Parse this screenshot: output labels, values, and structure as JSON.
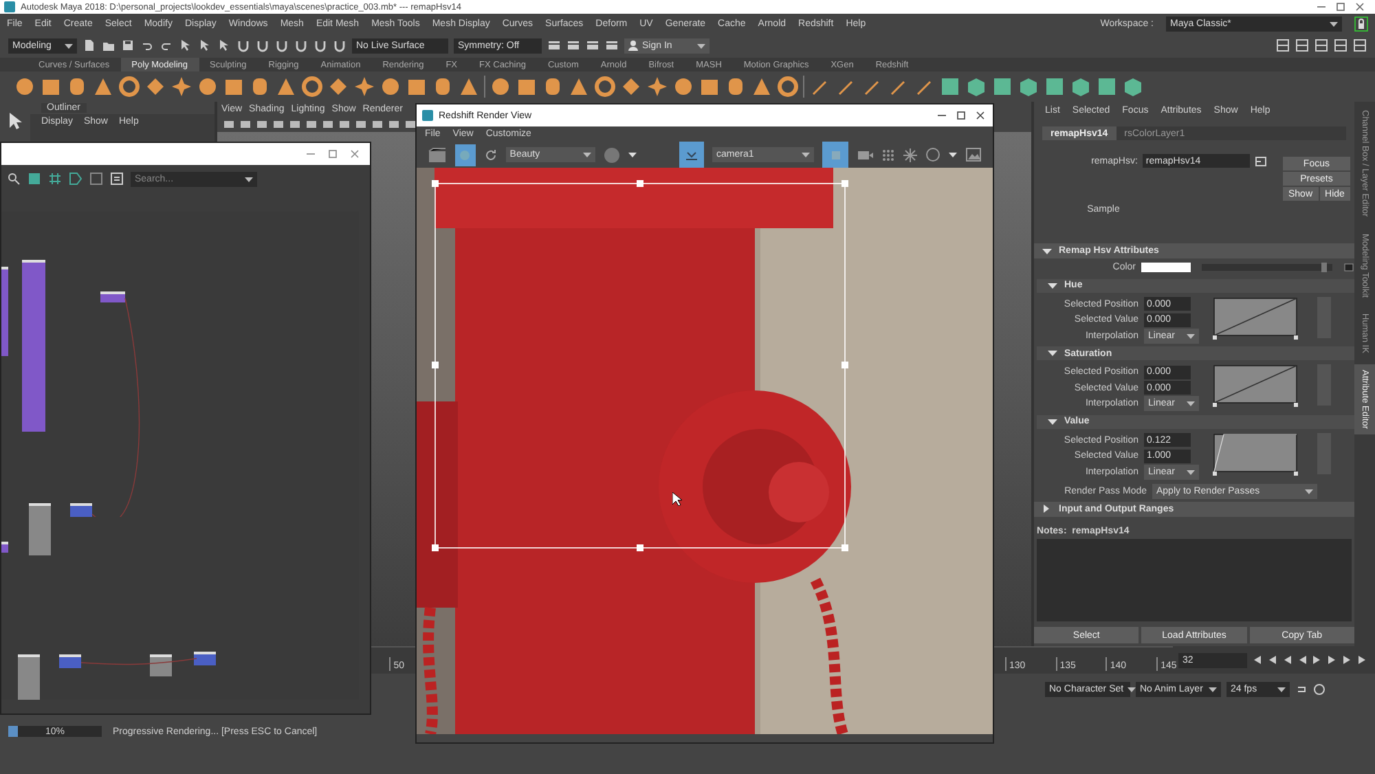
{
  "title_bar": {
    "title": "Autodesk Maya 2018: D:\\personal_projects\\lookdev_essentials\\maya\\scenes\\practice_003.mb* --- remapHsv14"
  },
  "menu_bar": {
    "items": [
      "File",
      "Edit",
      "Create",
      "Select",
      "Modify",
      "Display",
      "Windows",
      "Mesh",
      "Edit Mesh",
      "Mesh Tools",
      "Mesh Display",
      "Curves",
      "Surfaces",
      "Deform",
      "UV",
      "Generate",
      "Cache",
      "Arnold",
      "Redshift",
      "Help"
    ],
    "workspace_label": "Workspace :",
    "workspace": "Maya Classic*"
  },
  "status_line": {
    "menu_set": "Modeling",
    "live_surface": "No Live Surface",
    "symmetry": "Symmetry: Off",
    "sign_in": "Sign In"
  },
  "shelf": {
    "tabs": [
      {
        "label": "Curves / Surfaces",
        "selected": false
      },
      {
        "label": "Poly Modeling",
        "selected": true
      },
      {
        "label": "Sculpting",
        "selected": false
      },
      {
        "label": "Rigging",
        "selected": false
      },
      {
        "label": "Animation",
        "selected": false
      },
      {
        "label": "Rendering",
        "selected": false
      },
      {
        "label": "FX",
        "selected": false
      },
      {
        "label": "FX Caching",
        "selected": false
      },
      {
        "label": "Custom",
        "selected": false
      },
      {
        "label": "Arnold",
        "selected": false
      },
      {
        "label": "Bifrost",
        "selected": false
      },
      {
        "label": "MASH",
        "selected": false
      },
      {
        "label": "Motion Graphics",
        "selected": false
      },
      {
        "label": "XGen",
        "selected": false
      },
      {
        "label": "Redshift",
        "selected": false
      }
    ]
  },
  "outliner": {
    "title": "Outliner",
    "menus": [
      "Display",
      "Show",
      "Help"
    ]
  },
  "viewport": {
    "menus": [
      "View",
      "Shading",
      "Lighting",
      "Show",
      "Renderer"
    ]
  },
  "node_editor": {
    "search": {
      "placeholder": "Search..."
    }
  },
  "render_view": {
    "title": "Redshift Render View",
    "menus": [
      "File",
      "View",
      "Customize"
    ],
    "aov": "Beauty",
    "camera": "camera1"
  },
  "attribute_editor": {
    "menus": [
      "List",
      "Selected",
      "Focus",
      "Attributes",
      "Show",
      "Help"
    ],
    "tabs": [
      {
        "label": "remapHsv14",
        "selected": true
      },
      {
        "label": "rsColorLayer1",
        "selected": false
      }
    ],
    "node_label": "remapHsv:",
    "node_name": "remapHsv14",
    "buttons": [
      "Focus",
      "Presets",
      "Show",
      "Hide"
    ],
    "sample": "Sample",
    "main_section": {
      "title": "Remap Hsv Attributes",
      "expanded": true
    },
    "color": {
      "label": "Color",
      "level": 0.96
    },
    "sections": [
      {
        "title": "Hue",
        "expanded": true,
        "kind": "diagonal",
        "fields": [
          {
            "label": "Selected Position",
            "value": "0.000"
          },
          {
            "label": "Selected Value",
            "value": "0.000"
          }
        ],
        "interpolation_label": "Interpolation",
        "interpolation": "Linear"
      },
      {
        "title": "Saturation",
        "expanded": true,
        "kind": "diagonal",
        "fields": [
          {
            "label": "Selected Position",
            "value": "0.000"
          },
          {
            "label": "Selected Value",
            "value": "0.000"
          }
        ],
        "interpolation_label": "Interpolation",
        "interpolation": "Linear"
      },
      {
        "title": "Value",
        "expanded": true,
        "kind": "steep",
        "fields": [
          {
            "label": "Selected Position",
            "value": "0.122"
          },
          {
            "label": "Selected Value",
            "value": "1.000"
          }
        ],
        "interpolation_label": "Interpolation",
        "interpolation": "Linear"
      }
    ],
    "render_pass_label": "Render Pass Mode",
    "render_pass": "Apply to Render Passes",
    "ranges_section": {
      "title": "Input and Output Ranges",
      "expanded": false
    },
    "notes_label": "Notes:  remapHsv14",
    "bottom_buttons": [
      "Select",
      "Load Attributes",
      "Copy Tab"
    ]
  },
  "side_tabs": [
    {
      "label": "Channel Box / Layer Editor",
      "selected": false
    },
    {
      "label": "Modeling Toolkit",
      "selected": false
    },
    {
      "label": "Human IK",
      "selected": false
    },
    {
      "label": "Attribute Editor",
      "selected": true
    }
  ],
  "time_slider": {
    "left_ticks": [
      "50"
    ],
    "right_ticks": [
      "130",
      "135",
      "140",
      "145"
    ],
    "current_frame": "32"
  },
  "range_slider": {
    "character_set": "No Character Set",
    "anim_layer": "No Anim Layer",
    "fps": "24 fps"
  },
  "help_line": {
    "level": 0.1,
    "progress_label": "10%",
    "message": "Progressive Rendering... [Press ESC to Cancel]"
  }
}
